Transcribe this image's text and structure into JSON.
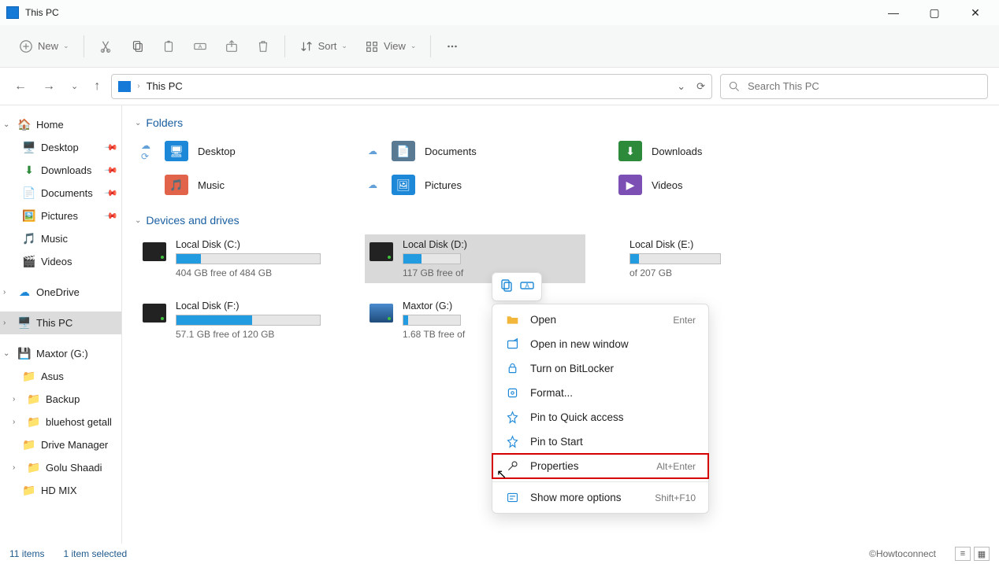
{
  "title": {
    "text": "This PC"
  },
  "toolbar": {
    "new_label": "New",
    "sort_label": "Sort",
    "view_label": "View"
  },
  "breadcrumb": {
    "current": "This PC"
  },
  "search": {
    "placeholder": "Search This PC"
  },
  "sidebar": {
    "home": "Home",
    "quick": {
      "desktop": "Desktop",
      "downloads": "Downloads",
      "documents": "Documents",
      "pictures": "Pictures",
      "music": "Music",
      "videos": "Videos"
    },
    "onedrive": "OneDrive",
    "thispc": "This PC",
    "maxtor": "Maxtor (G:)",
    "folders": {
      "asus": "Asus",
      "backup": "Backup",
      "bluehost": "bluehost getall",
      "drivemgr": "Drive Manager",
      "golu": "Golu Shaadi",
      "hdmix": "HD MIX"
    }
  },
  "sections": {
    "folders": "Folders",
    "drives": "Devices and drives"
  },
  "folders": {
    "desktop": "Desktop",
    "documents": "Documents",
    "downloads": "Downloads",
    "music": "Music",
    "pictures": "Pictures",
    "videos": "Videos"
  },
  "drives": {
    "c": {
      "name": "Local Disk (C:)",
      "free": "404 GB free of 484 GB",
      "pct": 17
    },
    "d": {
      "name": "Local Disk (D:)",
      "free": "117 GB free of",
      "pct": 32
    },
    "e": {
      "name": "Local Disk (E:)",
      "free": "of 207 GB",
      "pct": 10
    },
    "f": {
      "name": "Local Disk (F:)",
      "free": "57.1 GB free of 120 GB",
      "pct": 53
    },
    "g": {
      "name": "Maxtor (G:)",
      "free": "1.68 TB free of",
      "pct": 8
    }
  },
  "context": {
    "open": "Open",
    "open_hint": "Enter",
    "open_new": "Open in new window",
    "bitlocker": "Turn on BitLocker",
    "format": "Format...",
    "pin_quick": "Pin to Quick access",
    "pin_start": "Pin to Start",
    "properties": "Properties",
    "properties_hint": "Alt+Enter",
    "more": "Show more options",
    "more_hint": "Shift+F10"
  },
  "status": {
    "items": "11 items",
    "selected": "1 item selected",
    "brand": "©Howtoconnect"
  }
}
